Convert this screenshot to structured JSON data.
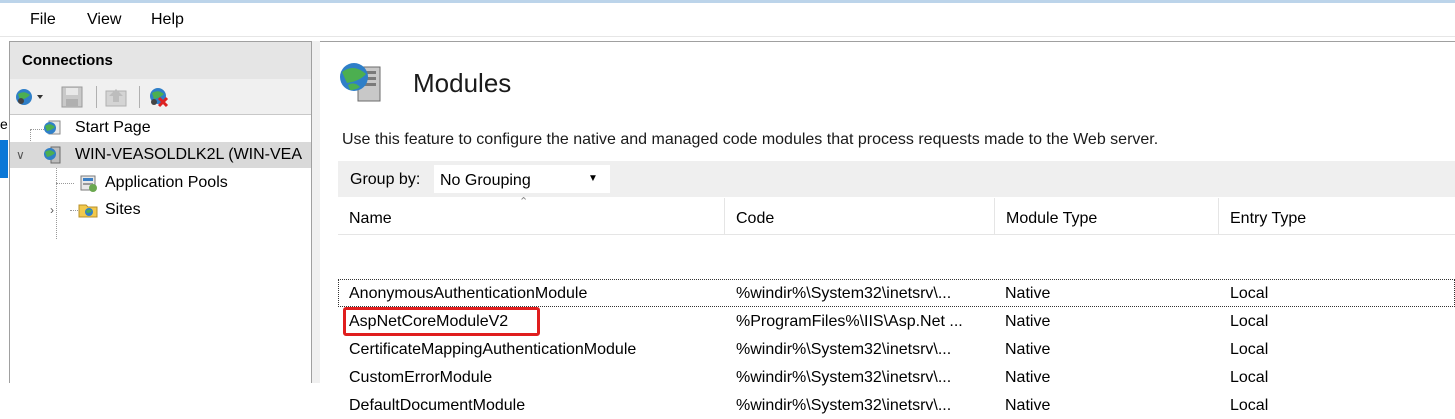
{
  "menu": {
    "items": [
      "File",
      "View",
      "Help"
    ]
  },
  "connections": {
    "title": "Connections",
    "toolbar": [
      "globe-connect-icon",
      "save-icon",
      "up-icon",
      "disconnect-icon"
    ],
    "tree": [
      {
        "label": "Start Page",
        "icon": "start-page-icon"
      },
      {
        "label": "WIN-VEASOLDLK2L (WIN-VEA",
        "icon": "server-icon"
      },
      {
        "label": "Application Pools",
        "icon": "app-pools-icon"
      },
      {
        "label": "Sites",
        "icon": "sites-icon"
      }
    ]
  },
  "edge": {
    "text": "e"
  },
  "page": {
    "title": "Modules",
    "description": "Use this feature to configure the native and managed code modules that process requests made to the Web server."
  },
  "group_by": {
    "label": "Group by:",
    "value": "No Grouping"
  },
  "table": {
    "columns": [
      "Name",
      "Code",
      "Module Type",
      "Entry Type"
    ],
    "rows": [
      {
        "name": "AnonymousAuthenticationModule",
        "code": "%windir%\\System32\\inetsrv\\...",
        "module_type": "Native",
        "entry_type": "Local"
      },
      {
        "name": "AspNetCoreModuleV2",
        "code": "%ProgramFiles%\\IIS\\Asp.Net ...",
        "module_type": "Native",
        "entry_type": "Local"
      },
      {
        "name": "CertificateMappingAuthenticationModule",
        "code": "%windir%\\System32\\inetsrv\\...",
        "module_type": "Native",
        "entry_type": "Local"
      },
      {
        "name": "CustomErrorModule",
        "code": "%windir%\\System32\\inetsrv\\...",
        "module_type": "Native",
        "entry_type": "Local"
      },
      {
        "name": "DefaultDocumentModule",
        "code": "%windir%\\System32\\inetsrv\\...",
        "module_type": "Native",
        "entry_type": "Local"
      }
    ]
  },
  "colors": {
    "accent": "#0b78d7",
    "highlight": "#e01e1e",
    "selection": "#d9d9d9"
  }
}
